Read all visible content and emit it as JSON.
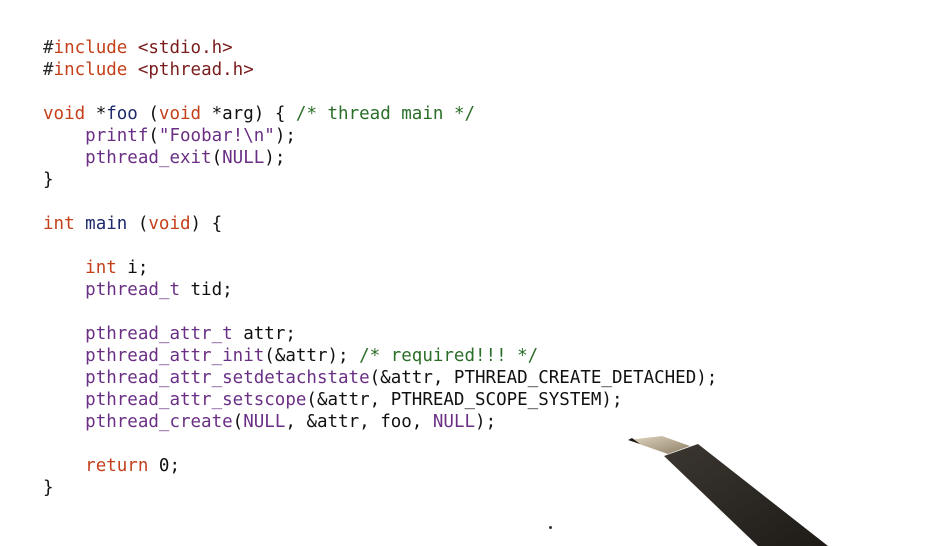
{
  "code_lines": [
    [
      {
        "t": "#",
        "c": "pp"
      },
      {
        "t": "include",
        "c": "inc"
      },
      {
        "t": " ",
        "c": "pl"
      },
      {
        "t": "<stdio.h>",
        "c": "hdr"
      }
    ],
    [
      {
        "t": "#",
        "c": "pp"
      },
      {
        "t": "include",
        "c": "inc"
      },
      {
        "t": " ",
        "c": "pl"
      },
      {
        "t": "<pthread.h>",
        "c": "hdr"
      }
    ],
    [],
    [
      {
        "t": "void",
        "c": "kw"
      },
      {
        "t": " *",
        "c": "pl"
      },
      {
        "t": "foo",
        "c": "fn"
      },
      {
        "t": " (",
        "c": "pl"
      },
      {
        "t": "void",
        "c": "kw"
      },
      {
        "t": " *arg) { ",
        "c": "pl"
      },
      {
        "t": "/* thread main */",
        "c": "cm"
      }
    ],
    [
      {
        "t": "    ",
        "c": "pl"
      },
      {
        "t": "printf",
        "c": "call"
      },
      {
        "t": "(",
        "c": "pl"
      },
      {
        "t": "\"Foobar!\\n\"",
        "c": "str"
      },
      {
        "t": ");",
        "c": "pl"
      }
    ],
    [
      {
        "t": "    ",
        "c": "pl"
      },
      {
        "t": "pthread_exit",
        "c": "call"
      },
      {
        "t": "(",
        "c": "pl"
      },
      {
        "t": "NULL",
        "c": "call"
      },
      {
        "t": ");",
        "c": "pl"
      }
    ],
    [
      {
        "t": "}",
        "c": "pl"
      }
    ],
    [],
    [
      {
        "t": "int",
        "c": "kw"
      },
      {
        "t": " ",
        "c": "pl"
      },
      {
        "t": "main",
        "c": "fn"
      },
      {
        "t": " (",
        "c": "pl"
      },
      {
        "t": "void",
        "c": "kw"
      },
      {
        "t": ") {",
        "c": "pl"
      }
    ],
    [],
    [
      {
        "t": "    ",
        "c": "pl"
      },
      {
        "t": "int",
        "c": "kw"
      },
      {
        "t": " i;",
        "c": "pl"
      }
    ],
    [
      {
        "t": "    ",
        "c": "pl"
      },
      {
        "t": "pthread_t",
        "c": "call"
      },
      {
        "t": " tid;",
        "c": "pl"
      }
    ],
    [],
    [
      {
        "t": "    ",
        "c": "pl"
      },
      {
        "t": "pthread_attr_t",
        "c": "call"
      },
      {
        "t": " attr;",
        "c": "pl"
      }
    ],
    [
      {
        "t": "    ",
        "c": "pl"
      },
      {
        "t": "pthread_attr_init",
        "c": "call"
      },
      {
        "t": "(&attr); ",
        "c": "pl"
      },
      {
        "t": "/* required!!! */",
        "c": "cm"
      }
    ],
    [
      {
        "t": "    ",
        "c": "pl"
      },
      {
        "t": "pthread_attr_setdetachstate",
        "c": "call"
      },
      {
        "t": "(&attr, PTHREAD_CREATE_DETACHED);",
        "c": "pl"
      }
    ],
    [
      {
        "t": "    ",
        "c": "pl"
      },
      {
        "t": "pthread_attr_setscope",
        "c": "call"
      },
      {
        "t": "(&attr, PTHREAD_SCOPE_SYSTEM);",
        "c": "pl"
      }
    ],
    [
      {
        "t": "    ",
        "c": "pl"
      },
      {
        "t": "pthread_create",
        "c": "call"
      },
      {
        "t": "(",
        "c": "pl"
      },
      {
        "t": "NULL",
        "c": "call"
      },
      {
        "t": ", &attr, foo, ",
        "c": "pl"
      },
      {
        "t": "NULL",
        "c": "call"
      },
      {
        "t": ");",
        "c": "pl"
      }
    ],
    [],
    [
      {
        "t": "    ",
        "c": "pl"
      },
      {
        "t": "return",
        "c": "kw"
      },
      {
        "t": " 0;",
        "c": "pl"
      }
    ],
    [
      {
        "t": "}",
        "c": "pl"
      }
    ]
  ],
  "decorations": {
    "pen_icon": "pen-tip",
    "pen_color": "#2a2620",
    "pen_tip_color": "#b9a88a"
  }
}
